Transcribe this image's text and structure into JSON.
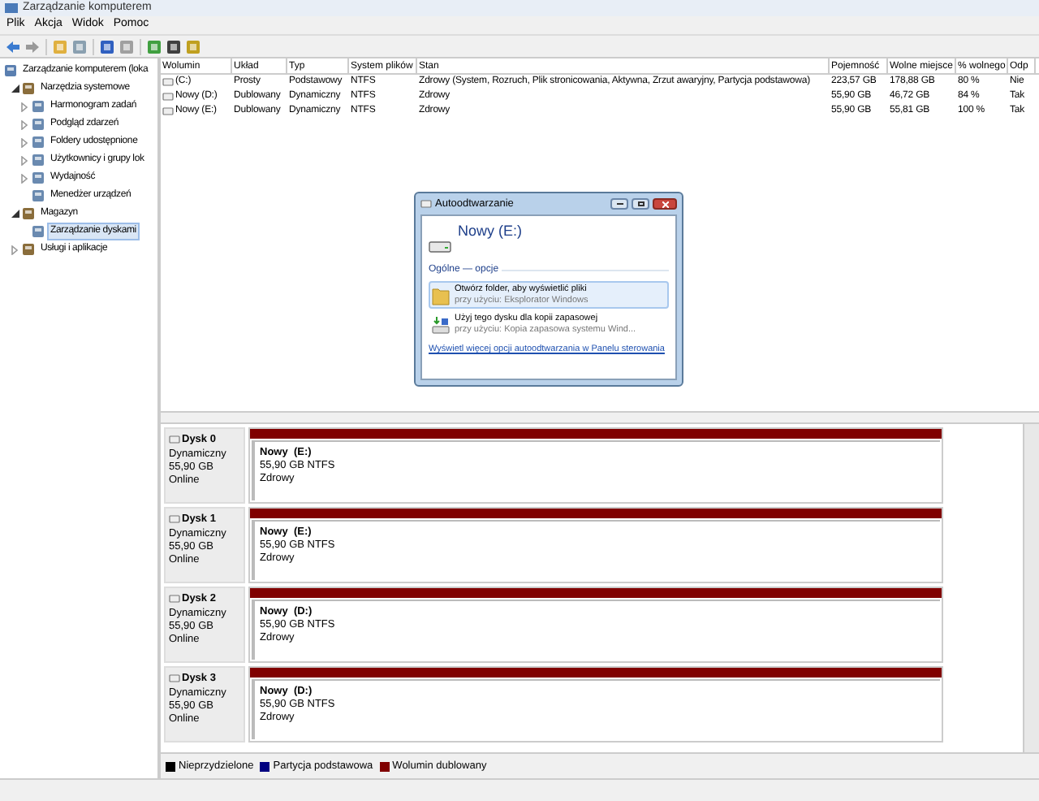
{
  "window": {
    "title": "Zarządzanie komputerem"
  },
  "menu": [
    "Plik",
    "Akcja",
    "Widok",
    "Pomoc"
  ],
  "tree": [
    {
      "label": "Zarządzanie komputerem (loka",
      "selected": false,
      "children": [
        {
          "label": "Narzędzia systemowe",
          "expanded": true,
          "selected": false,
          "children": [
            {
              "label": "Harmonogram zadań",
              "expanded": false,
              "selected": false
            },
            {
              "label": "Podgląd zdarzeń",
              "expanded": false,
              "selected": false
            },
            {
              "label": "Foldery udostępnione",
              "expanded": false,
              "selected": false
            },
            {
              "label": "Użytkownicy i grupy lok",
              "expanded": false,
              "selected": false
            },
            {
              "label": "Wydajność",
              "expanded": false,
              "selected": false
            },
            {
              "label": "Menedżer urządzeń",
              "selected": false
            }
          ]
        },
        {
          "label": "Magazyn",
          "expanded": true,
          "selected": false,
          "children": [
            {
              "label": "Zarządzanie dyskami",
              "selected": true
            }
          ]
        },
        {
          "label": "Usługi i aplikacje",
          "expanded": false,
          "selected": false
        }
      ]
    }
  ],
  "table": {
    "columns": [
      "Wolumin",
      "Układ",
      "Typ",
      "System plików",
      "Stan",
      "Pojemność",
      "Wolne miejsce",
      "% wolnego",
      "Odp"
    ],
    "rows": [
      [
        "(C:)",
        "Prosty",
        "Podstawowy",
        "NTFS",
        "Zdrowy (System, Rozruch, Plik stronicowania, Aktywna, Zrzut awaryjny, Partycja podstawowa)",
        "223,57 GB",
        "178,88 GB",
        "80 %",
        "Nie"
      ],
      [
        "Nowy (D:)",
        "Dublowany",
        "Dynamiczny",
        "NTFS",
        "Zdrowy",
        "55,90 GB",
        "46,72 GB",
        "84 %",
        "Tak"
      ],
      [
        "Nowy (E:)",
        "Dublowany",
        "Dynamiczny",
        "NTFS",
        "Zdrowy",
        "55,90 GB",
        "55,81 GB",
        "100 %",
        "Tak"
      ]
    ]
  },
  "disks": [
    {
      "name": "Dysk 0",
      "type": "Dynamiczny",
      "size": "55,90 GB",
      "status": "Online",
      "partition": {
        "name": "Nowy  (E:)",
        "info": "55,90 GB NTFS",
        "status": "Zdrowy",
        "kind": "mirrored"
      }
    },
    {
      "name": "Dysk 1",
      "type": "Dynamiczny",
      "size": "55,90 GB",
      "status": "Online",
      "partition": {
        "name": "Nowy  (E:)",
        "info": "55,90 GB NTFS",
        "status": "Zdrowy",
        "kind": "mirrored"
      }
    },
    {
      "name": "Dysk 2",
      "type": "Dynamiczny",
      "size": "55,90 GB",
      "status": "Online",
      "partition": {
        "name": "Nowy  (D:)",
        "info": "55,90 GB NTFS",
        "status": "Zdrowy",
        "kind": "mirrored"
      }
    },
    {
      "name": "Dysk 3",
      "type": "Dynamiczny",
      "size": "55,90 GB",
      "status": "Online",
      "partition": {
        "name": "Nowy  (D:)",
        "info": "55,90 GB NTFS",
        "status": "Zdrowy",
        "kind": "mirrored"
      }
    }
  ],
  "legend": [
    {
      "label": "Nieprzydzielone",
      "color": "#000000"
    },
    {
      "label": "Partycja podstawowa",
      "color": "#000080"
    },
    {
      "label": "Wolumin dublowany",
      "color": "#800000"
    }
  ],
  "dialog": {
    "title": "Autoodtwarzanie",
    "drive": "Nowy (E:)",
    "section": "Ogólne — opcje",
    "options": [
      {
        "title": "Otwórz folder, aby wyświetlić pliki",
        "subtitle": "przy użyciu: Eksplorator Windows",
        "selected": true
      },
      {
        "title": "Użyj tego dysku dla kopii zapasowej",
        "subtitle": "przy użyciu: Kopia zapasowa systemu Wind...",
        "selected": false
      }
    ],
    "link": "Wyświetl więcej opcji autoodtwarzania w Panelu sterowania"
  }
}
